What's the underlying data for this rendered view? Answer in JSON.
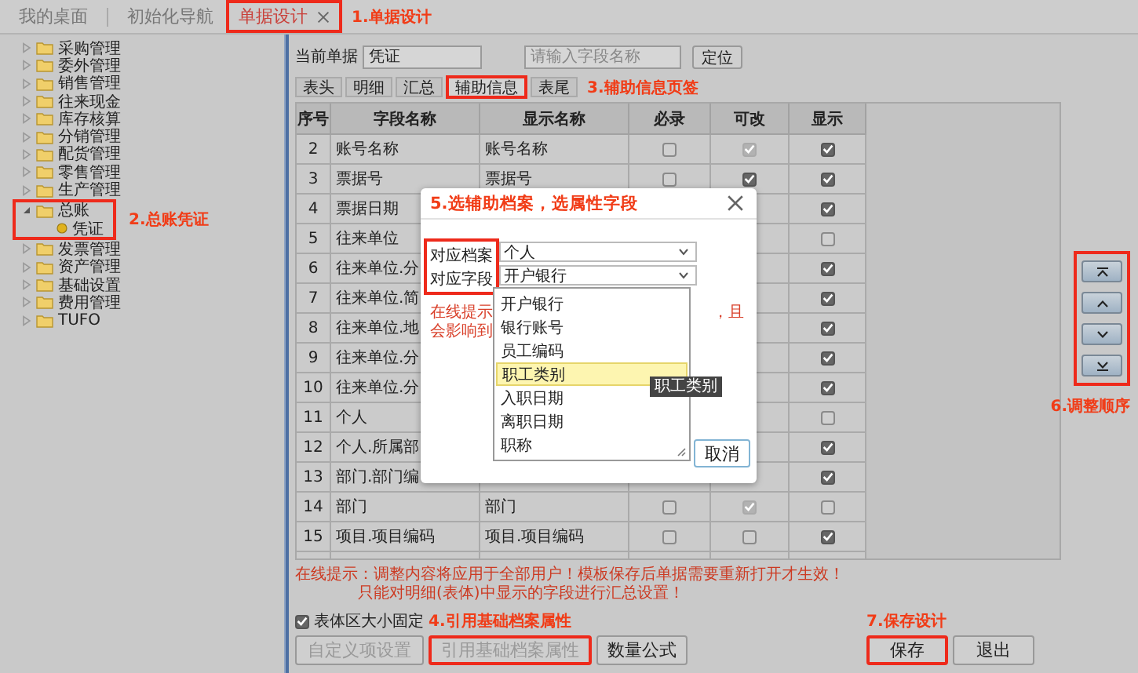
{
  "tabs": {
    "items": [
      {
        "label": "我的桌面",
        "selected": false,
        "closable": false,
        "highlighted": false
      },
      {
        "label": "初始化导航",
        "selected": false,
        "closable": false,
        "highlighted": false
      },
      {
        "label": "单据设计",
        "selected": true,
        "closable": true,
        "highlighted": true
      }
    ],
    "note": "1.单据设计"
  },
  "sidebar": {
    "items": [
      {
        "label": "采购管理",
        "expanded": false
      },
      {
        "label": "委外管理",
        "expanded": false
      },
      {
        "label": "销售管理",
        "expanded": false
      },
      {
        "label": "往来现金",
        "expanded": false
      },
      {
        "label": "库存核算",
        "expanded": false
      },
      {
        "label": "分销管理",
        "expanded": false
      },
      {
        "label": "配货管理",
        "expanded": false
      },
      {
        "label": "零售管理",
        "expanded": false
      },
      {
        "label": "生产管理",
        "expanded": false
      },
      {
        "label": "总账",
        "expanded": true,
        "highlighted": true,
        "note": "2.总账凭证",
        "children": [
          {
            "label": "凭证"
          }
        ]
      },
      {
        "label": "发票管理",
        "expanded": false
      },
      {
        "label": "资产管理",
        "expanded": false
      },
      {
        "label": "基础设置",
        "expanded": false
      },
      {
        "label": "费用管理",
        "expanded": false
      },
      {
        "label": "TUFO",
        "expanded": false
      }
    ]
  },
  "toolbar": {
    "label": "当前单据",
    "document": "凭证",
    "search_placeholder": "请输入字段名称",
    "locate_button": "定位"
  },
  "section_tabs": {
    "items": [
      {
        "label": "表头",
        "selected": false,
        "highlighted": false
      },
      {
        "label": "明细",
        "selected": false,
        "highlighted": false
      },
      {
        "label": "汇总",
        "selected": false,
        "highlighted": false
      },
      {
        "label": "辅助信息",
        "selected": true,
        "highlighted": true
      },
      {
        "label": "表尾",
        "selected": false,
        "highlighted": false
      }
    ],
    "note": "3.辅助信息页签"
  },
  "table": {
    "columns": [
      "序号",
      "字段名称",
      "显示名称",
      "必录",
      "可改",
      "显示"
    ],
    "rows": [
      {
        "no": "2",
        "field": "账号名称",
        "display": "账号名称",
        "required": {
          "checked": false,
          "disabled": false
        },
        "editable": {
          "checked": true,
          "disabled": true
        },
        "shown": {
          "checked": true,
          "disabled": false
        }
      },
      {
        "no": "3",
        "field": "票据号",
        "display": "票据号",
        "required": {
          "checked": false,
          "disabled": false
        },
        "editable": {
          "checked": true,
          "disabled": false
        },
        "shown": {
          "checked": true,
          "disabled": false
        }
      },
      {
        "no": "4",
        "field": "票据日期",
        "shown": {
          "checked": true,
          "disabled": false
        }
      },
      {
        "no": "5",
        "field": "往来单位",
        "shown": {
          "checked": false,
          "disabled": false
        }
      },
      {
        "no": "6",
        "field": "往来单位.分",
        "shown": {
          "checked": true,
          "disabled": false
        }
      },
      {
        "no": "7",
        "field": "往来单位.简",
        "shown": {
          "checked": true,
          "disabled": false
        }
      },
      {
        "no": "8",
        "field": "往来单位.地",
        "shown": {
          "checked": true,
          "disabled": false
        }
      },
      {
        "no": "9",
        "field": "往来单位.分",
        "shown": {
          "checked": true,
          "disabled": false
        }
      },
      {
        "no": "10",
        "field": "往来单位.分",
        "shown": {
          "checked": true,
          "disabled": false
        }
      },
      {
        "no": "11",
        "field": "个人",
        "shown": {
          "checked": false,
          "disabled": false
        }
      },
      {
        "no": "12",
        "field": "个人.所属部",
        "shown": {
          "checked": true,
          "disabled": false
        }
      },
      {
        "no": "13",
        "field": "部门.部门编",
        "shown": {
          "checked": true,
          "disabled": false
        }
      },
      {
        "no": "14",
        "field": "部门",
        "display": "部门",
        "required": {
          "checked": false,
          "disabled": false
        },
        "editable": {
          "checked": true,
          "disabled": true
        },
        "shown": {
          "checked": false,
          "disabled": false
        }
      },
      {
        "no": "15",
        "field": "项目.项目编码",
        "display": "项目.项目编码",
        "required": {
          "checked": false,
          "disabled": false
        },
        "editable": {
          "checked": false,
          "disabled": false
        },
        "shown": {
          "checked": true,
          "disabled": false
        }
      }
    ]
  },
  "order_buttons": {
    "highlighted": true,
    "note": "6.调整顺序",
    "buttons": [
      {
        "kind": "top"
      },
      {
        "kind": "up"
      },
      {
        "kind": "down"
      },
      {
        "kind": "bottom"
      }
    ]
  },
  "tips": [
    "在线提示：调整内容将应用于全部用户！模板保存后单据需要重新打开才生效！",
    "只能对明细(表体)中显示的字段进行汇总设置！"
  ],
  "fixed_size": {
    "label": "表体区大小固定",
    "checked": true
  },
  "buttons": [
    {
      "label": "自定义项设置",
      "disabled": true,
      "highlighted": false
    },
    {
      "label": "引用基础档案属性",
      "disabled": true,
      "highlighted": true,
      "note": "4.引用基础档案属性"
    },
    {
      "label": "数量公式",
      "disabled": false,
      "highlighted": false
    }
  ],
  "save_buttons": [
    {
      "label": "保存",
      "highlighted": true,
      "note": "7.保存设计"
    },
    {
      "label": "退出",
      "highlighted": false
    }
  ],
  "dialog": {
    "title": "5.选辅助档案，选属性字段",
    "labels_highlighted": true,
    "fields": [
      {
        "label": "对应档案",
        "value": "个人"
      },
      {
        "label": "对应字段",
        "value": "开户银行"
      }
    ],
    "tip_left": "在线提示",
    "tip_right": "，且",
    "tip_line2": "会影响到",
    "options": [
      {
        "label": "开户银行",
        "selected": false
      },
      {
        "label": "银行账号",
        "selected": false
      },
      {
        "label": "员工编码",
        "selected": false
      },
      {
        "label": "职工类别",
        "selected": true
      },
      {
        "label": "入职日期",
        "selected": false
      },
      {
        "label": "离职日期",
        "selected": false
      },
      {
        "label": "职称",
        "selected": false
      }
    ],
    "tooltip": "职工类别",
    "cancel_button": "取消"
  }
}
